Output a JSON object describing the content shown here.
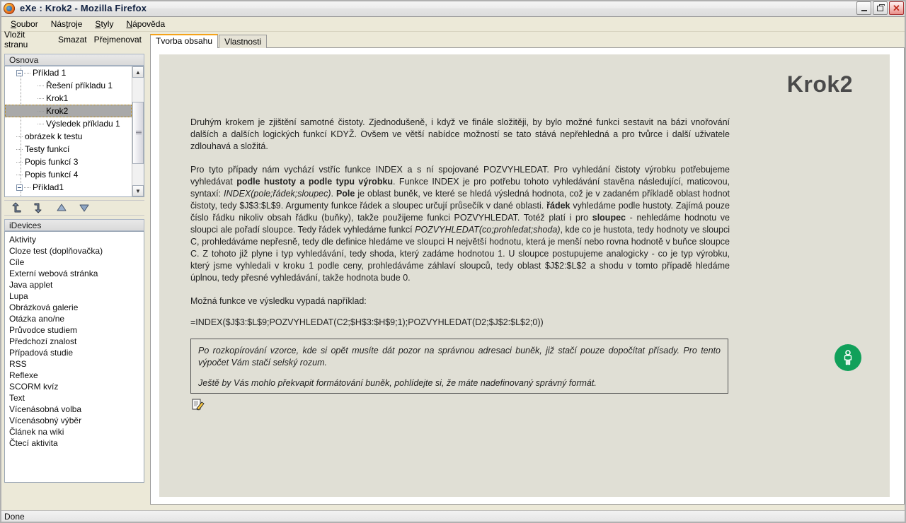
{
  "window": {
    "title": "eXe : Krok2 - Mozilla Firefox",
    "minimize_label": "–",
    "maximize_label": "❐",
    "close_label": "✕"
  },
  "menubar": {
    "items": [
      {
        "label": "Soubor",
        "mnemonic": "S"
      },
      {
        "label": "Nástroje",
        "mnemonic": "t"
      },
      {
        "label": "Styly",
        "mnemonic": "S"
      },
      {
        "label": "Nápověda",
        "mnemonic": "N"
      }
    ]
  },
  "outline_toolbar": {
    "items": [
      "Vložit stranu",
      "Smazat",
      "Přejmenovat"
    ]
  },
  "tabs": [
    {
      "label": "Tvorba obsahu",
      "active": true
    },
    {
      "label": "Vlastnosti",
      "active": false
    }
  ],
  "outline": {
    "header": "Osnova",
    "nodes": [
      {
        "label": "Příklad 1",
        "level": 0,
        "expander": true,
        "selected": false
      },
      {
        "label": "Řešení příkladu 1",
        "level": 1,
        "expander": false,
        "selected": false
      },
      {
        "label": "Krok1",
        "level": 1,
        "expander": false,
        "selected": false
      },
      {
        "label": "Krok2",
        "level": 1,
        "expander": false,
        "selected": true
      },
      {
        "label": "Výsledek příkladu 1",
        "level": 1,
        "expander": false,
        "selected": false
      },
      {
        "label": "obrázek k testu",
        "level": 0,
        "expander": false,
        "selected": false
      },
      {
        "label": "Testy funkcí",
        "level": 0,
        "expander": false,
        "selected": false
      },
      {
        "label": "Popis funkcí 3",
        "level": 0,
        "expander": false,
        "selected": false
      },
      {
        "label": "Popis funkcí 4",
        "level": 0,
        "expander": false,
        "selected": false
      },
      {
        "label": "Příklad1",
        "level": 0,
        "expander": true,
        "selected": false
      }
    ],
    "arrows": [
      {
        "name": "promote-arrow",
        "glyph": "↰"
      },
      {
        "name": "demote-arrow",
        "glyph": "↳"
      },
      {
        "name": "move-up-arrow",
        "glyph": "▲"
      },
      {
        "name": "move-down-arrow",
        "glyph": "▼"
      }
    ]
  },
  "idevices": {
    "header": "iDevices",
    "items": [
      "Aktivity",
      "Cloze test (doplňovačka)",
      "Cíle",
      "Externí webová stránka",
      "Java applet",
      "Lupa",
      "Obrázková galerie",
      "Otázka ano/ne",
      "Průvodce studiem",
      "Předchozí znalost",
      "Případová studie",
      "RSS",
      "Reflexe",
      "SCORM kvíz",
      "Text",
      "Vícenásobná volba",
      "Vícenásobný výběr",
      "Článek na wiki",
      "Čtecí aktivita"
    ]
  },
  "content": {
    "page_title": "Krok2",
    "paragraph1": "Druhým krokem je zjištění samotné čistoty. Zjednodušeně, i když ve finále složitěji, by bylo možné funkci sestavit na bázi vnořování dalších a dalších logických funkcí KDYŽ. Ovšem ve větší nabídce možností se tato stává nepřehledná a pro tvůrce i další uživatele zdlouhavá a složitá.",
    "paragraph2_a": "Pro tyto případy nám vychází vstříc funkce INDEX a s ní spojované POZVYHLEDAT. Pro vyhledání čistoty výrobku potřebujeme vyhledávat ",
    "paragraph2_b1": "podle hustoty a podle typu výrobku",
    "paragraph2_c": ". Funkce INDEX je pro potřebu tohoto vyhledávání stavěna následující, maticovou, syntaxí: ",
    "paragraph2_i1": "INDEX(pole;řádek;sloupec)",
    "paragraph2_d": ". ",
    "paragraph2_b2": "Pole",
    "paragraph2_e": " je oblast buněk, ve které se hledá výsledná hodnota, což je v zadaném příkladě oblast hodnot čistoty, tedy $J$3:$L$9. Argumenty funkce řádek a sloupec určují průsečík v dané oblasti. ",
    "paragraph2_b3": "řádek",
    "paragraph2_f": " vyhledáme podle hustoty. Zajímá pouze číslo řádku nikoliv obsah řádku (buňky), takže použijeme funkci POZVYHLEDAT. Totéž platí i pro ",
    "paragraph2_b4": "sloupec",
    "paragraph2_g": " - nehledáme hodnotu ve sloupci ale pořadí sloupce. Tedy řádek vyhledáme funkcí ",
    "paragraph2_i2": "POZVYHLEDAT(co;prohledat;shoda)",
    "paragraph2_h": ", kde co je hustota, tedy hodnoty ve sloupci C, prohledáváme nepřesně, tedy dle definice hledáme ve sloupci H největší hodnotu, která je menší nebo rovna hodnotě v buňce sloupce C. Z tohoto již plyne i typ vyhledávání, tedy shoda, který zadáme hodnotou 1. U sloupce postupujeme analogicky - co je typ výrobku, který jsme vyhledali v kroku 1 podle ceny, prohledáváme záhlaví sloupců, tedy oblast $J$2:$L$2 a shodu v tomto případě hledáme úplnou, tedy přesné vyhledávání, takže hodnota bude 0.",
    "paragraph3": "Možná funkce ve výsledku vypadá například:",
    "formula": "=INDEX($J$3:$L$9;POZVYHLEDAT(C2;$H$3:$H$9;1);POZVYHLEDAT(D2;$J$2:$L$2;0))",
    "note_line1": "Po rozkopírování vzorce, kde si opět musíte dát pozor na správnou adresaci buněk, již stačí pouze dopočítat přísady. Pro tento výpočet Vám stačí selský rozum.",
    "note_line2": "Ještě by Vás mohlo překvapit formátování buněk, pohlídejte si, že máte nadefinovaný správný formát."
  },
  "statusbar": {
    "text": "Done"
  },
  "colors": {
    "accent_tab": "#f5a31a",
    "page_bg": "#e0dfd5",
    "badge_green": "#11a05a",
    "selection_gray": "#a9a9a9",
    "title_text": "#4a4a4a"
  }
}
